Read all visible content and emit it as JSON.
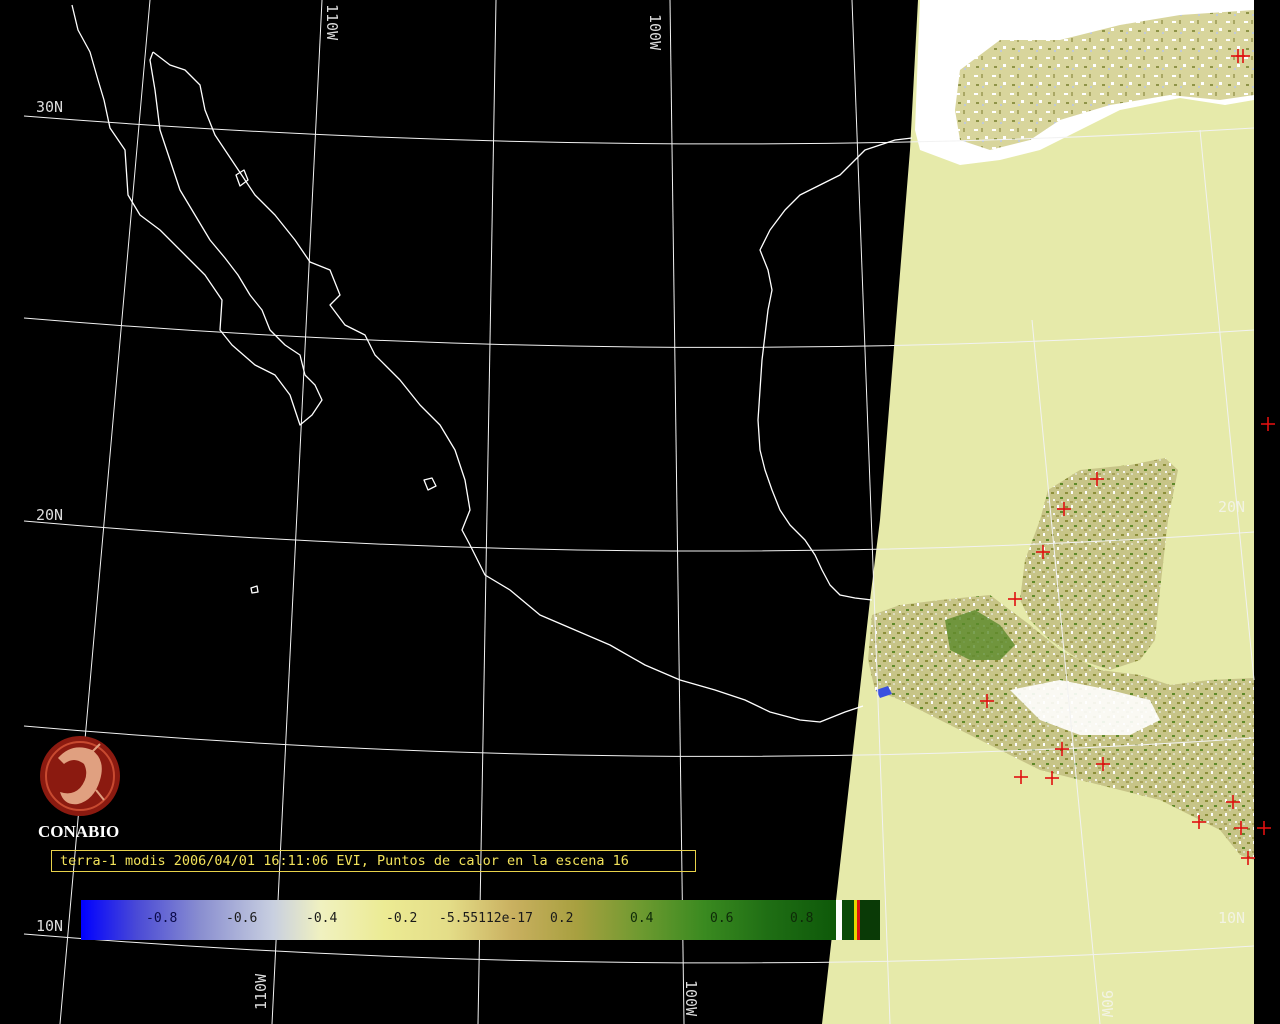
{
  "grid_labels": {
    "lat_30": "30N",
    "lat_20": "20N",
    "lat_10": "10N",
    "lon_110_top": "110W",
    "lon_100_top": "100W",
    "lon_110_bottom": "110W",
    "lon_100_bottom": "100W",
    "lat_20_right": "20N",
    "lat_10_right": "10N",
    "lon_90_bottom": "90W"
  },
  "logo": {
    "name": "CONABIO",
    "icon": "conabio-emblem-icon",
    "color": "#8b1a10"
  },
  "caption": "terra-1 modis 2006/04/01 16:11:06 EVI, Puntos de calor en la escena 16",
  "colorbar": {
    "ticks": [
      "-0.8",
      "-0.6",
      "-0.4",
      "-0.2",
      "-5.55112e-17",
      "0.2",
      "0.4",
      "0.6",
      "0.8"
    ]
  },
  "colors": {
    "background": "#000000",
    "swath_land": "#e6eaaa",
    "coastline": "#ffffff",
    "hotspot": "#e01010"
  }
}
